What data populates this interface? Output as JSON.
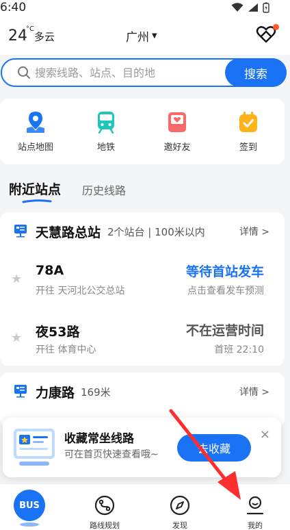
{
  "status_bar": {
    "time": "6:40"
  },
  "header": {
    "temperature": "24",
    "temp_unit": "°C",
    "weather": "多云",
    "city": "广州"
  },
  "search": {
    "placeholder": "搜索线路、站点、目的地",
    "button_label": "搜索"
  },
  "quick_actions": [
    {
      "label": "站点地图",
      "icon": "station-map-icon"
    },
    {
      "label": "地铁",
      "icon": "metro-icon"
    },
    {
      "label": "邀好友",
      "icon": "invite-icon"
    },
    {
      "label": "签到",
      "icon": "checkin-icon"
    }
  ],
  "tabs": {
    "active": "附近站点",
    "inactive": "历史线路"
  },
  "stations": [
    {
      "name": "天慧路总站",
      "meta": "2个站台 | 100米以内",
      "detail": "详情 >",
      "lines": [
        {
          "number": "78A",
          "direction": "开往 天河北公交总站",
          "status": "等待首站发车",
          "status_color": "#1a73f5",
          "sub": "点击查看发车预测"
        },
        {
          "number": "夜53路",
          "direction": "开往 体育中心",
          "status": "不在运营时间",
          "status_color": "#555555",
          "sub": "首班 22:10"
        }
      ]
    },
    {
      "name": "力康路",
      "meta": "169米",
      "detail": "详情 >"
    }
  ],
  "promo": {
    "title": "收藏常坐线路",
    "subtitle": "可在首页快速查看哦~",
    "button_label": "去收藏",
    "close": "×"
  },
  "bottom_nav": {
    "bus_label": "BUS",
    "items": [
      {
        "label": "路线规划",
        "icon": "route-plan-icon"
      },
      {
        "label": "发现",
        "icon": "compass-icon"
      },
      {
        "label": "我的",
        "icon": "profile-icon"
      }
    ]
  },
  "colors": {
    "accent": "#1a73f5",
    "promo_dot": "#ff5a2a",
    "arrow": "#ff2d2d"
  }
}
